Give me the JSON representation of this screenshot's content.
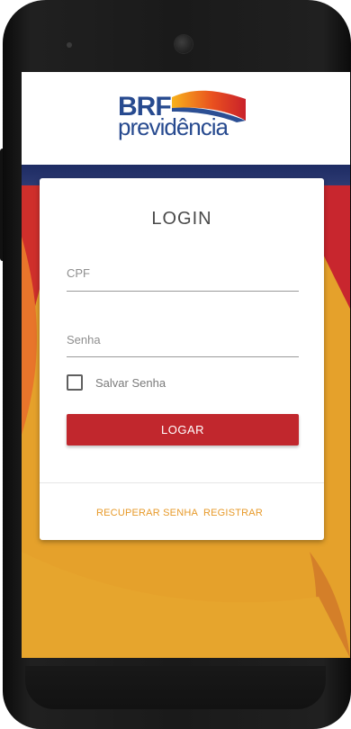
{
  "logo": {
    "brf": "BRF",
    "previdencia": "previdência"
  },
  "login": {
    "title": "LOGIN",
    "cpf_placeholder": "CPF",
    "senha_placeholder": "Senha",
    "save_password_label": "Salvar Senha",
    "save_password_checked": false,
    "submit_label": "LOGAR"
  },
  "links": {
    "recover_password": "RECUPERAR SENHA",
    "register": "REGISTRAR"
  },
  "colors": {
    "brand_blue": "#274a8f",
    "primary_red": "#c1272d",
    "accent_orange": "#e79a2a",
    "background_yellow": "#e5a12b",
    "band_navy": "#1d2b63"
  }
}
